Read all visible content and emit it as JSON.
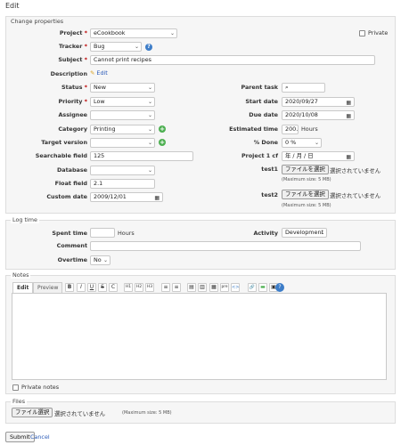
{
  "page_title": "Edit",
  "properties": {
    "legend": "Change properties",
    "private_label": "Private",
    "project": {
      "label": "Project",
      "value": "eCookbook"
    },
    "tracker": {
      "label": "Tracker",
      "value": "Bug"
    },
    "subject": {
      "label": "Subject",
      "value": "Cannot print recipes"
    },
    "description": {
      "label": "Description",
      "edit_link": "Edit"
    },
    "status": {
      "label": "Status",
      "value": "New"
    },
    "priority": {
      "label": "Priority",
      "value": "Low"
    },
    "assignee": {
      "label": "Assignee",
      "value": ""
    },
    "category": {
      "label": "Category",
      "value": "Printing"
    },
    "target_version": {
      "label": "Target version",
      "value": ""
    },
    "searchable_field": {
      "label": "Searchable field",
      "value": "125"
    },
    "database": {
      "label": "Database",
      "value": ""
    },
    "float_field": {
      "label": "Float field",
      "value": "2.1"
    },
    "custom_date": {
      "label": "Custom date",
      "value": "2009/12/01"
    },
    "parent_task": {
      "label": "Parent task",
      "value": ""
    },
    "start_date": {
      "label": "Start date",
      "value": "2020/09/27"
    },
    "due_date": {
      "label": "Due date",
      "value": "2020/10/08"
    },
    "estimated_time": {
      "label": "Estimated time",
      "value": "200.",
      "unit": "Hours"
    },
    "done": {
      "label": "% Done",
      "value": "0 %"
    },
    "project_1_cf": {
      "label": "Project 1 cf",
      "value": "年 / 月 / 日"
    },
    "test1": {
      "label": "test1",
      "button": "ファイルを選択",
      "status": "選択されていません",
      "max": "(Maximum size: 5 MB)"
    },
    "test2": {
      "label": "test2",
      "button": "ファイルを選択",
      "status": "選択されていません",
      "max": "(Maximum size: 5 MB)"
    }
  },
  "log_time": {
    "legend": "Log time",
    "spent_time": {
      "label": "Spent time",
      "value": "",
      "unit": "Hours"
    },
    "activity": {
      "label": "Activity",
      "value": "Development"
    },
    "comment": {
      "label": "Comment",
      "value": ""
    },
    "overtime": {
      "label": "Overtime",
      "value": "No"
    }
  },
  "notes": {
    "legend": "Notes",
    "tab_edit": "Edit",
    "tab_preview": "Preview",
    "toolbar": [
      "B",
      "I",
      "U",
      "S",
      "C",
      "H1",
      "H2",
      "H3",
      "≡",
      "≡",
      "▤",
      "▥",
      "▦",
      "pre",
      "<>",
      "🔗",
      "▬",
      "▣",
      "?"
    ],
    "private_notes": "Private notes"
  },
  "files": {
    "legend": "Files",
    "button": "ファイル選択",
    "status": "選択されていません",
    "max": "(Maximum size: 5 MB)"
  },
  "actions": {
    "submit": "Submit",
    "cancel": "Cancel"
  }
}
